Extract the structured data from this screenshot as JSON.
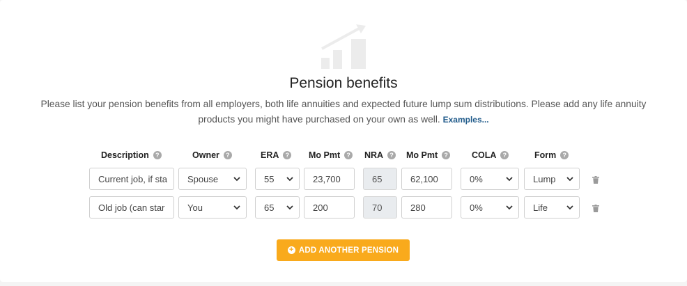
{
  "title": "Pension benefits",
  "description": "Please list your pension benefits from all employers, both life annuities and expected future lump sum distributions. Please add any life annuity products you might have purchased on your own as well.",
  "examples_link": "Examples...",
  "columns": {
    "description": "Description",
    "owner": "Owner",
    "era": "ERA",
    "mo_pmt_era": "Mo Pmt",
    "nra": "NRA",
    "mo_pmt_nra": "Mo Pmt",
    "cola": "COLA",
    "form": "Form"
  },
  "help_glyph": "?",
  "rows": [
    {
      "description": "Current job, if sta",
      "owner": "Spouse",
      "era": "55",
      "mo_pmt_era": "23,700",
      "nra": "65",
      "mo_pmt_nra": "62,100",
      "cola": "0%",
      "form": "Lump"
    },
    {
      "description": "Old job (can star",
      "owner": "You",
      "era": "65",
      "mo_pmt_era": "200",
      "nra": "70",
      "mo_pmt_nra": "280",
      "cola": "0%",
      "form": "Life"
    }
  ],
  "add_button": "ADD ANOTHER PENSION",
  "icons": {
    "hero": "chart-growth-icon",
    "help": "question-circle-icon",
    "delete": "trash-icon",
    "dropdown": "chevron-down-icon",
    "add": "plus-circle-icon"
  },
  "colors": {
    "accent": "#f9aa1c",
    "link": "#1f5a8a",
    "help_icon": "#a9a9a9",
    "readonly_bg": "#e9ecef"
  }
}
